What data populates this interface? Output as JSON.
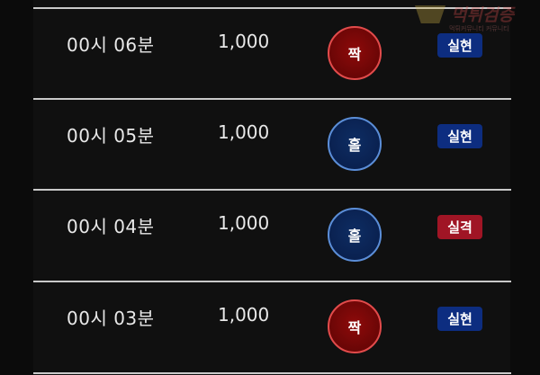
{
  "rows": [
    {
      "time": "00시 06분",
      "amount": "1,000",
      "pick": "짝",
      "pick_type": "even",
      "result": "실현",
      "result_type": "hit"
    },
    {
      "time": "00시 05분",
      "amount": "1,000",
      "pick": "홀",
      "pick_type": "odd",
      "result": "실현",
      "result_type": "hit"
    },
    {
      "time": "00시 04분",
      "amount": "1,000",
      "pick": "홀",
      "pick_type": "odd",
      "result": "실격",
      "result_type": "miss"
    },
    {
      "time": "00시 03분",
      "amount": "1,000",
      "pick": "짝",
      "pick_type": "even",
      "result": "실현",
      "result_type": "hit"
    }
  ],
  "watermark": {
    "title": "먹튀검증",
    "subtitle": "먹튀커뮤니티 커뮤니티"
  },
  "colors": {
    "even_ball": "#7a0808",
    "odd_ball": "#0c2659",
    "hit_badge": "#0d2d80",
    "miss_badge": "#a01525"
  }
}
